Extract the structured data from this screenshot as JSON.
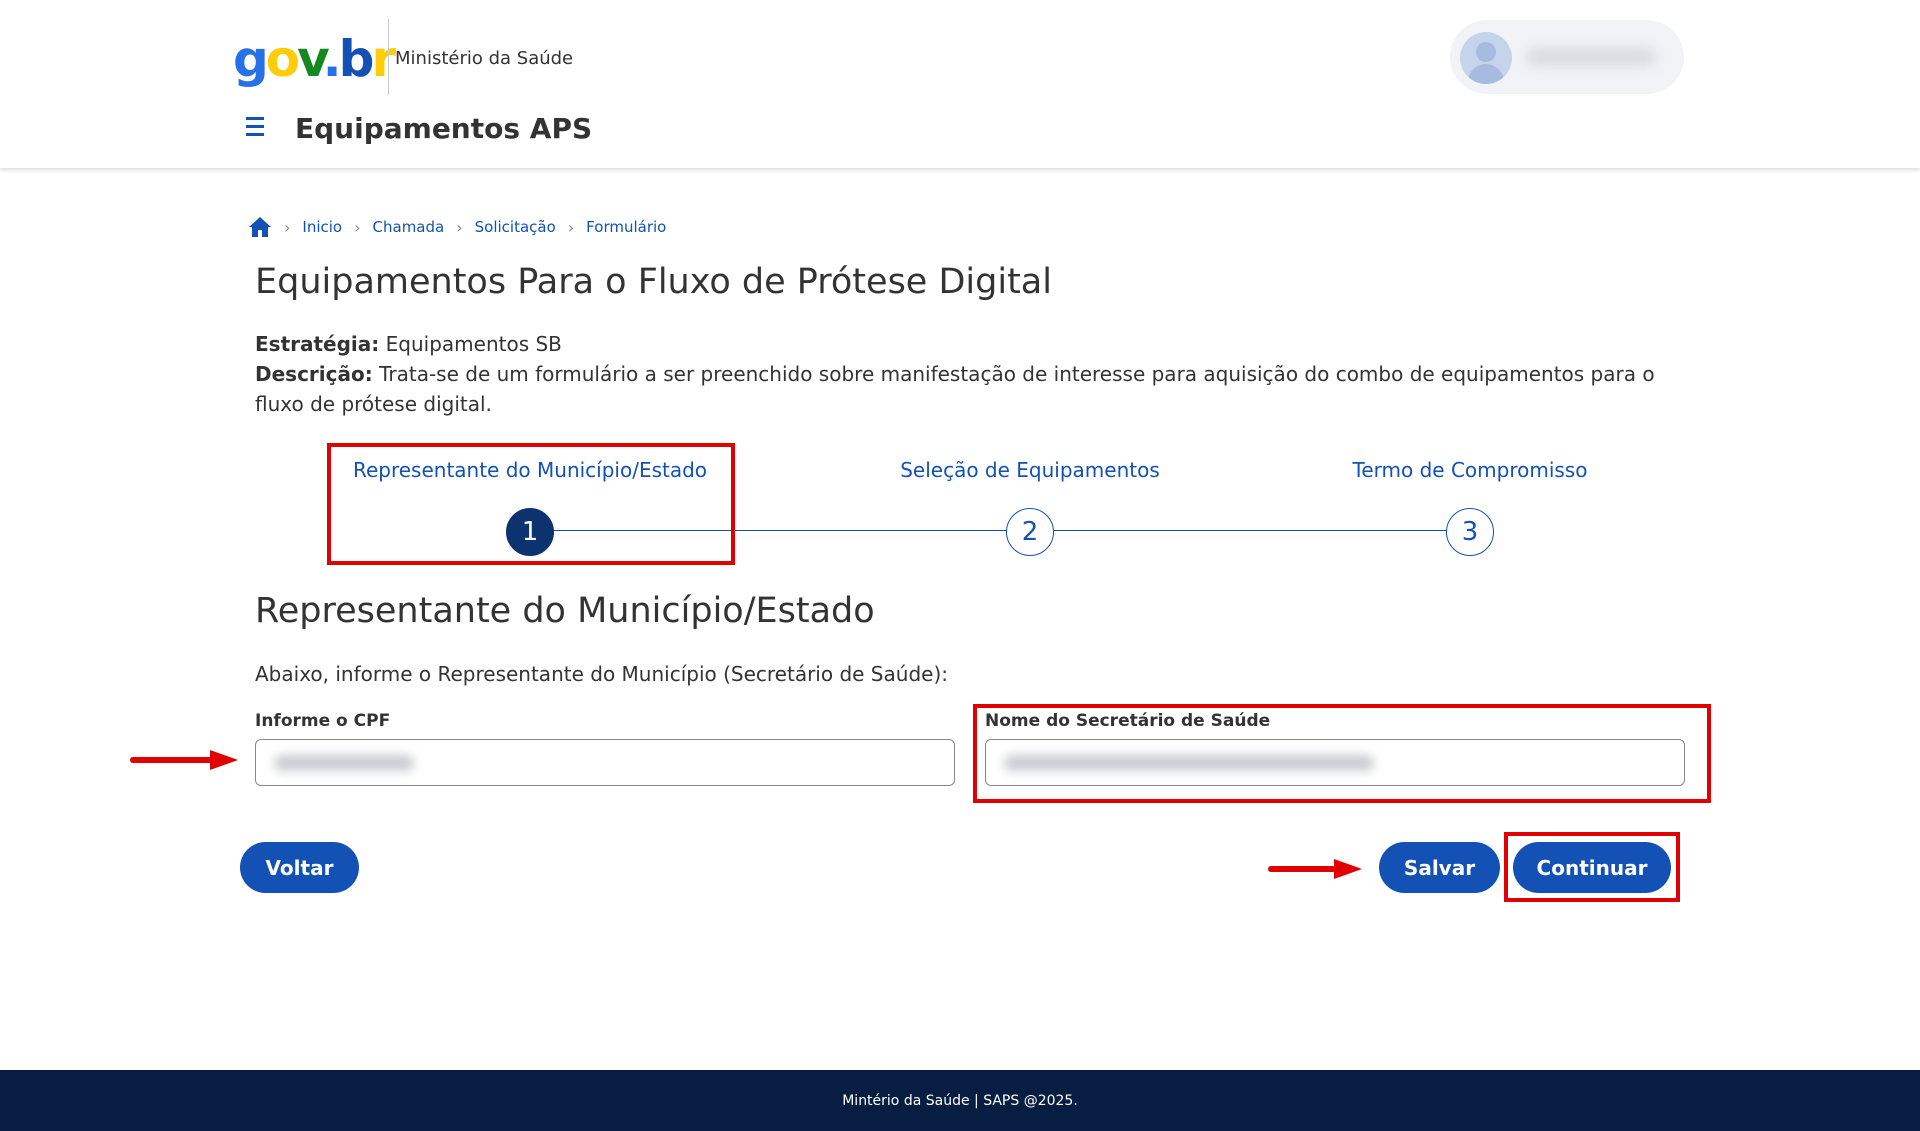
{
  "header": {
    "logo_text": {
      "g": "g",
      "o": "o",
      "v": "v",
      "dot": ".",
      "b": "b",
      "r": "r"
    },
    "ministry": "Ministério da Saúde",
    "app_title": "Equipamentos APS"
  },
  "breadcrumb": {
    "items": [
      "Inicio",
      "Chamada",
      "Solicitação",
      "Formulário"
    ]
  },
  "page": {
    "title": "Equipamentos Para o Fluxo de Prótese Digital",
    "strategy_label": "Estratégia:",
    "strategy_value": "Equipamentos SB",
    "description_label": "Descrição:",
    "description_value": "Trata-se de um formulário a ser preenchido sobre manifestação de interesse para aquisição do combo de equipamentos para o fluxo de prótese digital."
  },
  "stepper": {
    "steps": [
      {
        "label": "Representante do Município/Estado",
        "number": "1",
        "active": true
      },
      {
        "label": "Seleção de Equipamentos",
        "number": "2",
        "active": false
      },
      {
        "label": "Termo de Compromisso",
        "number": "3",
        "active": false
      }
    ]
  },
  "form": {
    "section_title": "Representante do Município/Estado",
    "instruction": "Abaixo, informe o Representante do Município (Secretário de Saúde):",
    "cpf_label": "Informe o CPF",
    "name_label": "Nome do Secretário de Saúde"
  },
  "actions": {
    "back": "Voltar",
    "save": "Salvar",
    "continue": "Continuar"
  },
  "footer": {
    "text": "Mintério da Saúde | SAPS @2025."
  },
  "colors": {
    "primary": "#1351b4",
    "active_step": "#0c326f",
    "highlight": "#e00000",
    "footer_bg": "#071d41"
  }
}
